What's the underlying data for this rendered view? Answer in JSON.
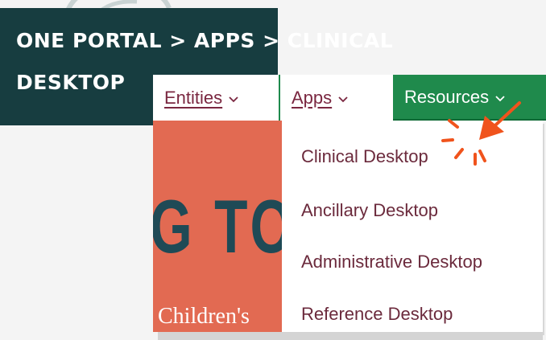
{
  "banner": {
    "line1": "ONE PORTAL > APPS > CLINICAL",
    "line2": "DESKTOP"
  },
  "nav": {
    "entities_label": "Entities",
    "apps_label": "Apps",
    "resources_label": "Resources"
  },
  "hero": {
    "big_text": "G TO",
    "small_text": "Children's"
  },
  "dropdown": {
    "items": [
      {
        "label": "Clinical Desktop"
      },
      {
        "label": "Ancillary Desktop"
      },
      {
        "label": "Administrative Desktop"
      },
      {
        "label": "Reference Desktop"
      }
    ]
  },
  "colors": {
    "banner_bg": "#173d40",
    "nav_link": "#7a2740",
    "resources_bg": "#1f8a4c",
    "hero_bg": "#e26a52",
    "pointer": "#f0531c"
  },
  "icons": {
    "chevron": "chevron-down-icon",
    "pointer": "arrow-pointer-icon",
    "logo": "logo-arc-icon"
  }
}
